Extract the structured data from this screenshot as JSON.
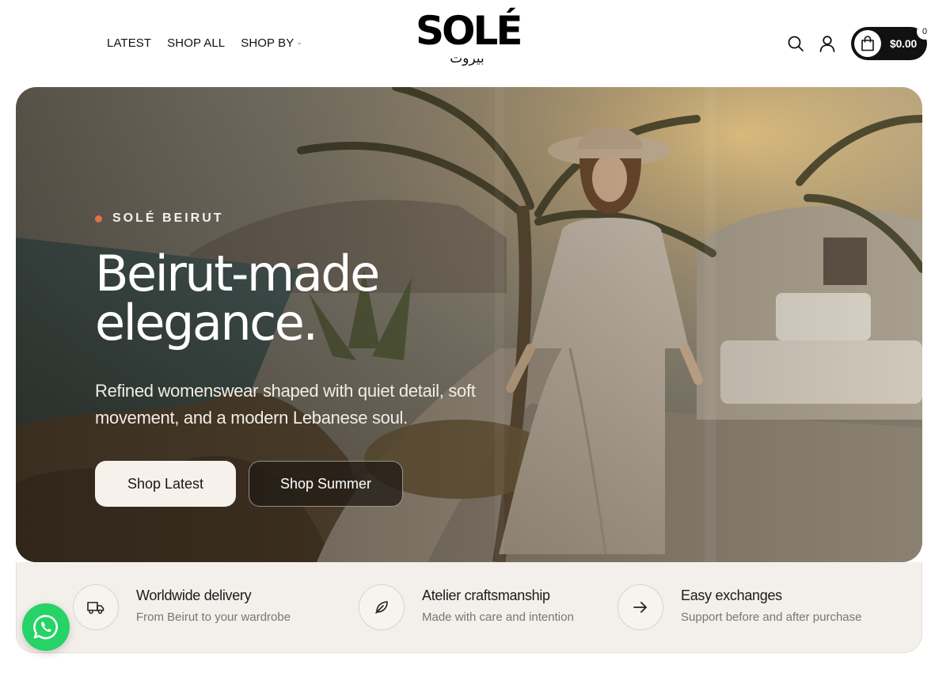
{
  "header": {
    "nav": [
      {
        "label": "LATEST"
      },
      {
        "label": "SHOP ALL"
      },
      {
        "label": "SHOP BY"
      }
    ],
    "logo": {
      "main": "SOLÉ",
      "sub": "بيروت"
    },
    "cart": {
      "total": "$0.00",
      "count": "0"
    }
  },
  "hero": {
    "eyebrow": "SOLÉ BEIRUT",
    "title_line1": "Beirut-made",
    "title_line2": "elegance.",
    "subtitle": "Refined womenswear shaped with quiet detail, soft movement, and a modern Lebanese soul.",
    "primary_button": "Shop Latest",
    "secondary_button": "Shop Summer",
    "accent_color": "#e46f4e"
  },
  "features": [
    {
      "icon": "truck-icon",
      "title": "Worldwide delivery",
      "desc": "From Beirut to your wardrobe"
    },
    {
      "icon": "leaf-icon",
      "title": "Atelier craftsmanship",
      "desc": "Made with care and intention"
    },
    {
      "icon": "arrow-right-icon",
      "title": "Easy exchanges",
      "desc": "Support before and after purchase"
    }
  ],
  "colors": {
    "whatsapp": "#25d366",
    "panel": "#f3efea"
  }
}
